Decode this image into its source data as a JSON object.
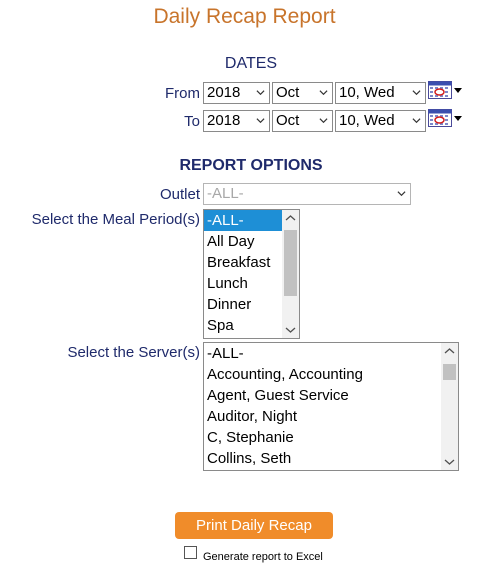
{
  "page": {
    "title": "Daily Recap Report"
  },
  "dates": {
    "heading": "DATES",
    "from_label": "From",
    "to_label": "To",
    "from": {
      "year": "2018",
      "month": "Oct",
      "day": "10, Wed"
    },
    "to": {
      "year": "2018",
      "month": "Oct",
      "day": "10, Wed"
    }
  },
  "report_options": {
    "heading": "REPORT OPTIONS",
    "outlet_label": "Outlet",
    "outlet_value": "-ALL-",
    "meal_label": "Select the Meal Period(s)",
    "meal_options": [
      "-ALL-",
      "All Day",
      "Breakfast",
      "Lunch",
      "Dinner",
      "Spa"
    ],
    "server_label": "Select the Server(s)",
    "server_options": [
      "-ALL-",
      "Accounting, Accounting",
      "Agent, Guest Service",
      "Auditor, Night",
      "C, Stephanie",
      "Collins, Seth"
    ]
  },
  "actions": {
    "print_label": "Print Daily Recap",
    "excel_label": "Generate report to Excel"
  },
  "colors": {
    "title": "#c8742b",
    "label": "#1f2a6b",
    "button": "#f08c2a",
    "selected": "#1e8fd6"
  }
}
